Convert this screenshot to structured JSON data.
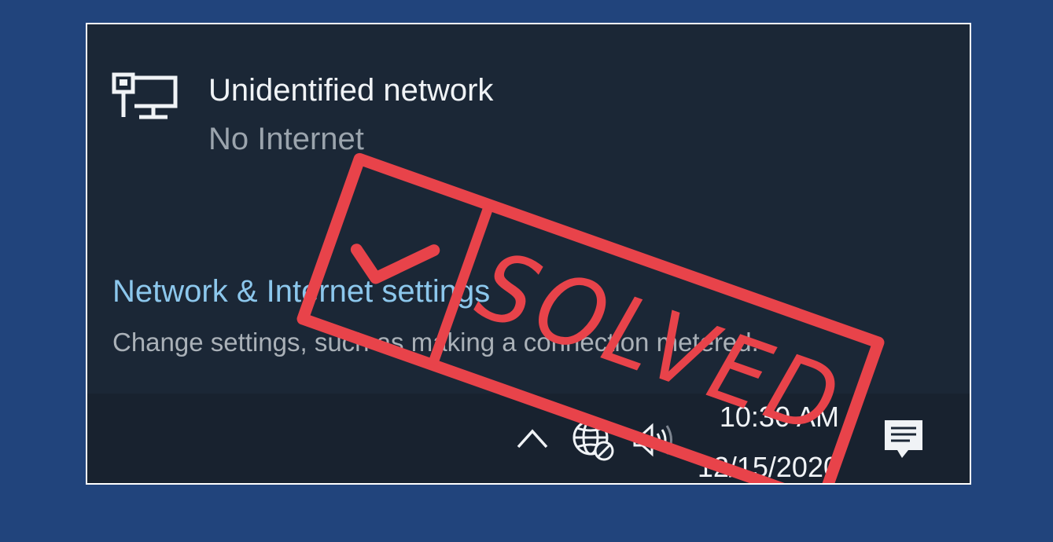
{
  "network": {
    "icon": "wired-network-monitor-icon",
    "name": "Unidentified network",
    "status": "No Internet"
  },
  "settings": {
    "link_label": "Network & Internet settings",
    "description": "Change settings, such as making a connection metered."
  },
  "tray": {
    "icons": [
      "chevron-up-icon",
      "globe-no-internet-icon",
      "volume-icon"
    ],
    "time": "10:30 AM",
    "date": "12/15/2020",
    "notification_icon": "action-center-icon"
  },
  "stamp": {
    "text": "SOLVED",
    "icon": "checkmark-icon",
    "color": "#e8434a"
  },
  "colors": {
    "page_background": "#21447c",
    "flyout_background": "#1b2736",
    "link": "#8cc7ec",
    "stamp": "#e8434a"
  }
}
